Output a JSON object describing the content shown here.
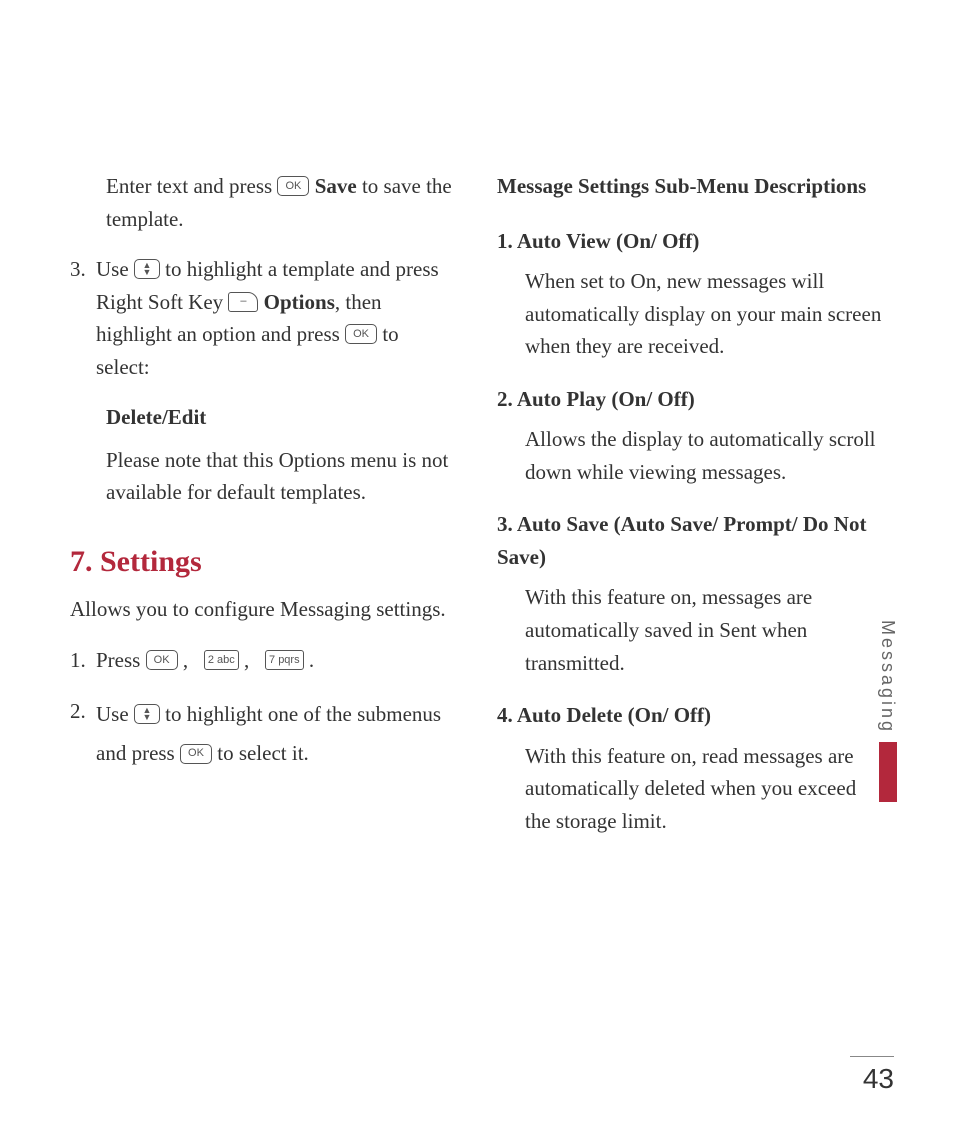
{
  "left": {
    "intro_a": "Enter text and press ",
    "intro_ok": "OK",
    "intro_save": " Save",
    "intro_b": " to save the template.",
    "step3_num": "3.",
    "step3_a": "Use ",
    "step3_b": " to highlight a template and press Right Soft Key ",
    "step3_opts": " Options",
    "step3_c": ", then highlight an option and press ",
    "step3_d": " to select:",
    "sub1": "Delete/Edit",
    "note": "Please note that this Options menu is not available for default templates.",
    "sec_title": "7. Settings",
    "sec_intro": "Allows you to configure Messaging settings.",
    "s1_num": "1.",
    "s1_a": "Press ",
    "k2": "2 abc",
    "k7": "7 pqrs",
    "s2_num": "2.",
    "s2_a": "Use ",
    "s2_b": " to highlight one of the submenus and press ",
    "s2_c": " to select it."
  },
  "right": {
    "head": "Message Settings Sub-Menu Descriptions",
    "i1_t": "1. Auto View (On/ Off)",
    "i1_b": "When set to On, new messages will automatically display on your main screen when they are received.",
    "i2_t": "2. Auto Play (On/ Off)",
    "i2_b": "Allows the display to automatically scroll down while viewing messages.",
    "i3_t": "3. Auto Save (Auto Save/ Prompt/ Do Not Save)",
    "i3_b": "With this feature on, messages are automatically saved in Sent when transmitted.",
    "i4_t": "4. Auto Delete (On/ Off)",
    "i4_b": "With this feature on, read messages are automatically deleted when you exceed the storage limit."
  },
  "tab": "Messaging",
  "page": "43"
}
